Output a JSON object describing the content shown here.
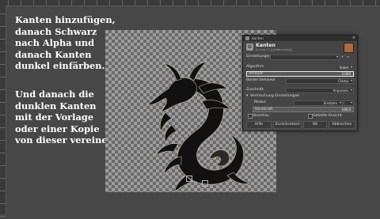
{
  "note": {
    "top_lines": [
      "Kanten hinzufügen,",
      "danach Schwarz",
      "nach Alpha und",
      "danach Kanten",
      "dunkel einfärben."
    ],
    "bottom_lines": [
      "Und danach die",
      "dunklen Kanten",
      "mit der Vorlage",
      "oder einer Kopie",
      "von dieser vereinen."
    ]
  },
  "dialog": {
    "window_title": "Kanten",
    "heading": "Kanten",
    "subheading": "[4-ring-77 ([Unbenannt])]",
    "presets_label": "Einstellungen",
    "presets_value": "",
    "algorithm_label": "Algorithm",
    "algorithm_value": "Sobel",
    "amount_label": "Amount",
    "amount_value": "2,000",
    "border_label": "Border behavior",
    "border_value": "Clamp",
    "clipping_label": "Zuschnitt",
    "clipping_value": "Anpassen",
    "blending_label": "Vermischung Einstellungen",
    "mode_label": "Modus",
    "mode_value": "Ersetzen",
    "opacity_label": "Deckkraft",
    "opacity_value": "100,0",
    "preview_label": "Vorschau",
    "split_label": "Geteilte Ansicht",
    "buttons": {
      "help": "Hilfe",
      "reset": "Zurücksetzen",
      "ok": "OK",
      "cancel": "Abbrechen"
    }
  },
  "colors": {
    "workspace": "#474747",
    "dialog_bg": "#454545",
    "highlight_row": "#5a5a5a"
  }
}
